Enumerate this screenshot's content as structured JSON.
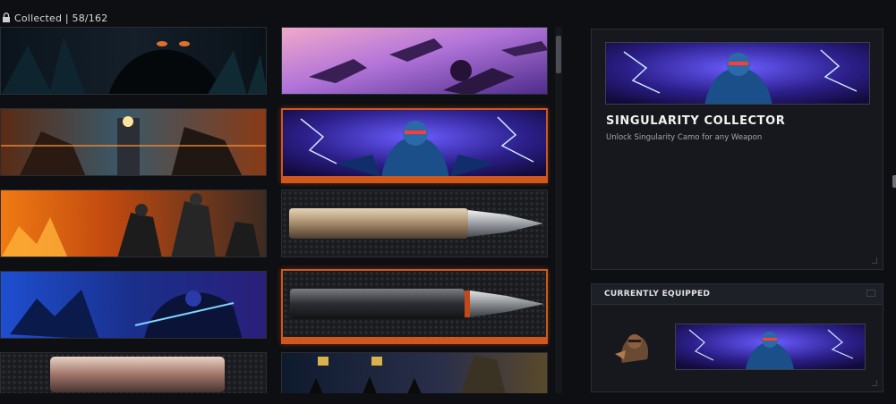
{
  "header": {
    "collected_text": "Collected | 58/162",
    "lock_icon": "lock-icon"
  },
  "grid": {
    "cards": [
      {
        "name": "dark-beast",
        "col": 0,
        "row": 0,
        "equipped": false
      },
      {
        "name": "purple-jets",
        "col": 1,
        "row": 0,
        "equipped": false
      },
      {
        "name": "gunfight",
        "col": 0,
        "row": 1,
        "equipped": false
      },
      {
        "name": "singularity",
        "col": 1,
        "row": 1,
        "equipped": true
      },
      {
        "name": "ninja-fire",
        "col": 0,
        "row": 2,
        "equipped": false
      },
      {
        "name": "silver-bullet",
        "col": 1,
        "row": 2,
        "equipped": false
      },
      {
        "name": "blue-storm",
        "col": 0,
        "row": 3,
        "equipped": false
      },
      {
        "name": "black-bullet",
        "col": 1,
        "row": 3,
        "equipped": true
      },
      {
        "name": "copper-bullet",
        "col": 0,
        "row": 4,
        "equipped": false
      },
      {
        "name": "ninja-hall",
        "col": 1,
        "row": 4,
        "equipped": false
      }
    ],
    "scroll_fraction": 0.0
  },
  "detail": {
    "title": "SINGULARITY COLLECTOR",
    "description": "Unlock Singularity Camo for any Weapon"
  },
  "equipped": {
    "header": "CURRENTLY EQUIPPED"
  },
  "colors": {
    "accent": "#d2571d",
    "panel": "#16181d",
    "background": "#0d0f13"
  }
}
